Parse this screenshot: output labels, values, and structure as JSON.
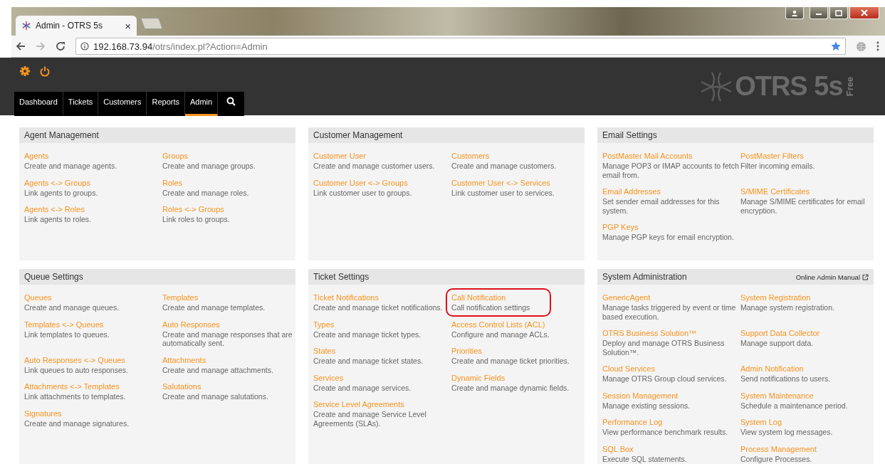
{
  "browser": {
    "tab_title": "Admin - OTRS 5s",
    "tab_close": "×",
    "url_host": "192.168.73.94",
    "url_path": "/otrs/index.pl?Action=Admin"
  },
  "header": {
    "logo": "OTRS 5s",
    "logo_edition": "Free",
    "nav": [
      {
        "label": "Dashboard",
        "selected": false
      },
      {
        "label": "Tickets",
        "selected": false
      },
      {
        "label": "Customers",
        "selected": false
      },
      {
        "label": "Reports",
        "selected": false
      },
      {
        "label": "Admin",
        "selected": true
      }
    ]
  },
  "sections": [
    {
      "title": "Agent Management",
      "items": [
        {
          "title": "Agents",
          "desc": "Create and manage agents.",
          "circled": false
        },
        {
          "title": "Groups",
          "desc": "Create and manage groups.",
          "circled": false
        },
        {
          "title": "Agents <-> Groups",
          "desc": "Link agents to groups.",
          "circled": false
        },
        {
          "title": "Roles",
          "desc": "Create and manage roles.",
          "circled": false
        },
        {
          "title": "Agents <-> Roles",
          "desc": "Link agents to roles.",
          "circled": false
        },
        {
          "title": "Roles <-> Groups",
          "desc": "Link roles to groups.",
          "circled": false
        }
      ]
    },
    {
      "title": "Customer Management",
      "items": [
        {
          "title": "Customer User",
          "desc": "Create and manage customer users.",
          "circled": false
        },
        {
          "title": "Customers",
          "desc": "Create and manage customers.",
          "circled": false
        },
        {
          "title": "Customer User <-> Groups",
          "desc": "Link customer user to groups.",
          "circled": false
        },
        {
          "title": "Customer User <-> Services",
          "desc": "Link customer user to services.",
          "circled": false
        }
      ]
    },
    {
      "title": "Email Settings",
      "items": [
        {
          "title": "PostMaster Mail Accounts",
          "desc": "Manage POP3 or IMAP accounts to fetch email from.",
          "circled": false
        },
        {
          "title": "PostMaster Filters",
          "desc": "Filter incoming emails.",
          "circled": false
        },
        {
          "title": "Email Addresses",
          "desc": "Set sender email addresses for this system.",
          "circled": false
        },
        {
          "title": "S/MIME Certificates",
          "desc": "Manage S/MIME certificates for email encryption.",
          "circled": false
        },
        {
          "title": "PGP Keys",
          "desc": "Manage PGP keys for email encryption.",
          "circled": false
        }
      ]
    },
    {
      "title": "Queue Settings",
      "items": [
        {
          "title": "Queues",
          "desc": "Create and manage queues.",
          "circled": false
        },
        {
          "title": "Templates",
          "desc": "Create and manage templates.",
          "circled": false
        },
        {
          "title": "Templates <-> Queues",
          "desc": "Link templates to queues.",
          "circled": false
        },
        {
          "title": "Auto Responses",
          "desc": "Create and manage responses that are automatically sent.",
          "circled": false
        },
        {
          "title": "Auto Responses <-> Queues",
          "desc": "Link queues to auto responses.",
          "circled": false
        },
        {
          "title": "Attachments",
          "desc": "Create and manage attachments.",
          "circled": false
        },
        {
          "title": "Attachments <-> Templates",
          "desc": "Link attachments to templates.",
          "circled": false
        },
        {
          "title": "Salutations",
          "desc": "Create and manage salutations.",
          "circled": false
        },
        {
          "title": "Signatures",
          "desc": "Create and manage signatures.",
          "circled": false
        }
      ]
    },
    {
      "title": "Ticket Settings",
      "items": [
        {
          "title": "Ticket Notifications",
          "desc": "Create and manage ticket notifications.",
          "circled": false
        },
        {
          "title": "Call Notification",
          "desc": "Call notification settings",
          "circled": true
        },
        {
          "title": "Types",
          "desc": "Create and manage ticket types.",
          "circled": false
        },
        {
          "title": "Access Control Lists (ACL)",
          "desc": "Configure and manage ACLs.",
          "circled": false
        },
        {
          "title": "States",
          "desc": "Create and manage ticket states.",
          "circled": false
        },
        {
          "title": "Priorities",
          "desc": "Create and manage ticket priorities.",
          "circled": false
        },
        {
          "title": "Services",
          "desc": "Create and manage services.",
          "circled": false
        },
        {
          "title": "Dynamic Fields",
          "desc": "Create and manage dynamic fields.",
          "circled": false
        },
        {
          "title": "Service Level Agreements",
          "desc": "Create and manage Service Level Agreements (SLAs).",
          "circled": false
        }
      ]
    },
    {
      "title": "System Administration",
      "header_link": "Online Admin Manual",
      "items": [
        {
          "title": "GenericAgent",
          "desc": "Manage tasks triggered by event or time based execution.",
          "circled": false
        },
        {
          "title": "System Registration",
          "desc": "Manage system registration.",
          "circled": false
        },
        {
          "title": "OTRS Business Solution™",
          "desc": "Deploy and manage OTRS Business Solution™.",
          "circled": false
        },
        {
          "title": "Support Data Collector",
          "desc": "Manage support data.",
          "circled": false
        },
        {
          "title": "Cloud Services",
          "desc": "Manage OTRS Group cloud services.",
          "circled": false
        },
        {
          "title": "Admin Notification",
          "desc": "Send notifications to users.",
          "circled": false
        },
        {
          "title": "Session Management",
          "desc": "Manage existing sessions.",
          "circled": false
        },
        {
          "title": "System Maintenance",
          "desc": "Schedule a maintenance period.",
          "circled": false
        },
        {
          "title": "Performance Log",
          "desc": "View performance benchmark results.",
          "circled": false
        },
        {
          "title": "System Log",
          "desc": "View system log messages.",
          "circled": false
        },
        {
          "title": "SQL Box",
          "desc": "Execute SQL statements.",
          "circled": false
        },
        {
          "title": "Process Management",
          "desc": "Configure Processes.",
          "circled": false
        }
      ]
    }
  ]
}
